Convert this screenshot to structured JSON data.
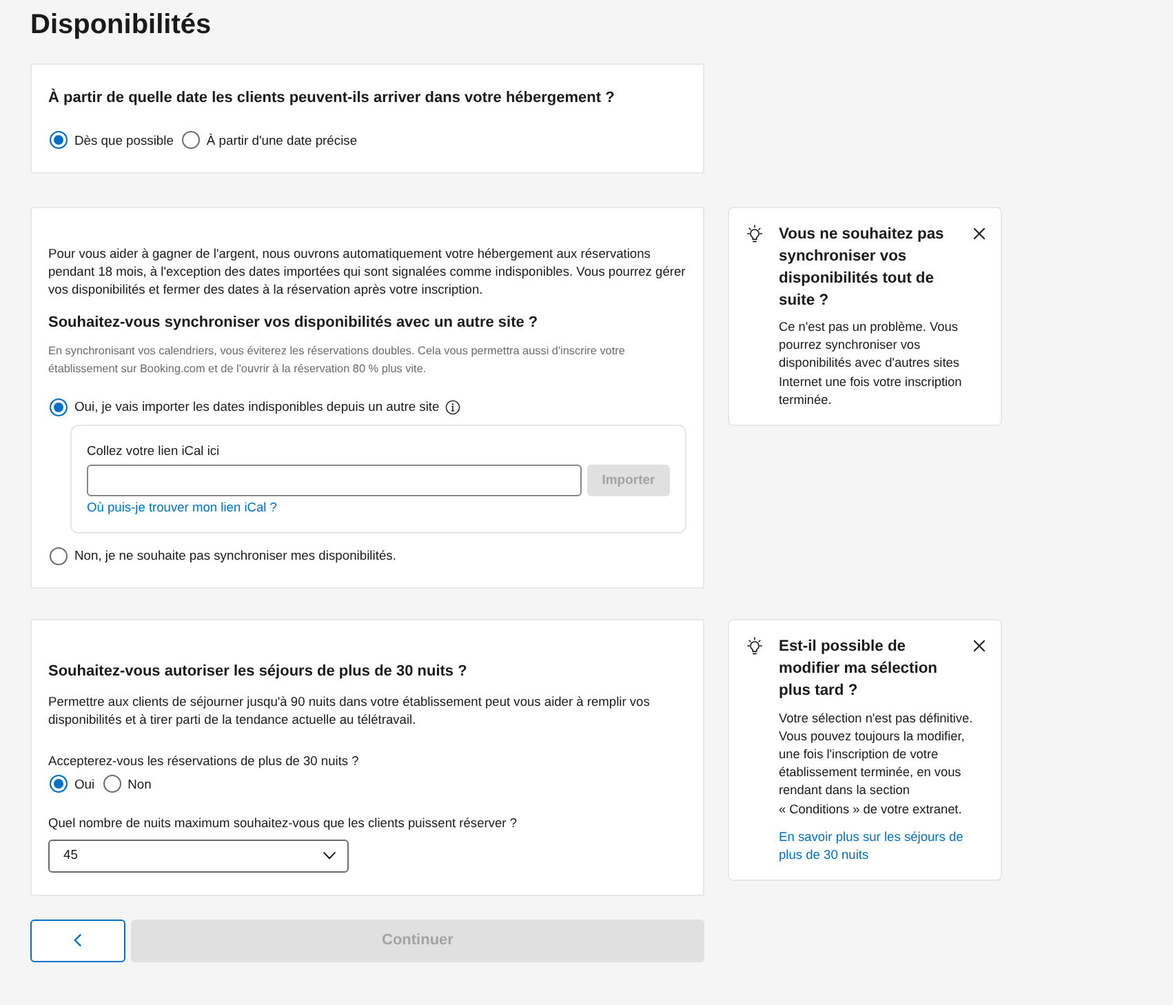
{
  "page": {
    "title": "Disponibilités"
  },
  "arrival": {
    "question": "À partir de quelle date les clients peuvent-ils arriver dans votre hébergement ?",
    "options": [
      {
        "label": "Dès que possible",
        "selected": true
      },
      {
        "label": "À partir d'une date précise",
        "selected": false
      }
    ]
  },
  "sync": {
    "intro": "Pour vous aider à gagner de l'argent, nous ouvrons automatiquement votre hébergement aux réservations pendant 18 mois, à l'exception des dates importées qui sont signalées comme indisponibles. Vous pourrez gérer vos disponibilités et fermer des dates à la réservation après votre inscription.",
    "question": "Souhaitez-vous synchroniser vos disponibilités avec un autre site ?",
    "hint": "En synchronisant vos calendriers, vous éviterez les réservations doubles. Cela vous permettra aussi d'inscrire votre établissement sur Booking.com et de l'ouvrir à la réservation 80 % plus vite.",
    "options": [
      {
        "label": "Oui, je vais importer les dates indisponibles depuis un autre site",
        "selected": true,
        "info_icon": true,
        "ical": {
          "label": "Collez votre lien iCal ici",
          "button": {
            "label": "Importer",
            "disabled": true
          },
          "help_link": "Où puis-je trouver mon lien iCal ?"
        }
      },
      {
        "label": "Non, je ne souhaite pas synchroniser mes disponibilités.",
        "selected": false,
        "info_icon": false
      }
    ],
    "tip": {
      "title": "Vous ne souhaitez pas synchroniser vos disponibilités tout de suite ?",
      "body": "Ce n'est pas un problème. Vous pourrez synchroniser vos disponibilités avec d'autres sites Internet une fois votre inscription terminée."
    }
  },
  "long_stays": {
    "question": "Souhaitez-vous autoriser les séjours de plus de 30 nuits ?",
    "description": "Permettre aux clients de séjourner jusqu'à 90 nuits dans votre établissement peut vous aider à remplir vos disponibilités et à tirer parti de la tendance actuelle au télétravail.",
    "accept_label": "Accepterez-vous les réservations de plus de 30 nuits ?",
    "accept_options": [
      {
        "label": "Oui",
        "selected": true
      },
      {
        "label": "Non",
        "selected": false
      }
    ],
    "max_label": "Quel nombre de nuits maximum souhaitez-vous que les clients puissent réserver ?",
    "max_nights": {
      "value": "45"
    },
    "tip": {
      "title": "Est-il possible de modifier ma sélection plus tard ?",
      "body": "Votre sélection n'est pas définitive. Vous pouvez toujours la modifier, une fois l'inscription de votre établissement terminée, en vous rendant dans la section « Conditions » de votre extranet.",
      "link": "En savoir plus sur les séjours de plus de 30 nuits"
    }
  },
  "footer": {
    "continue": {
      "label": "Continuer",
      "disabled": true
    }
  }
}
